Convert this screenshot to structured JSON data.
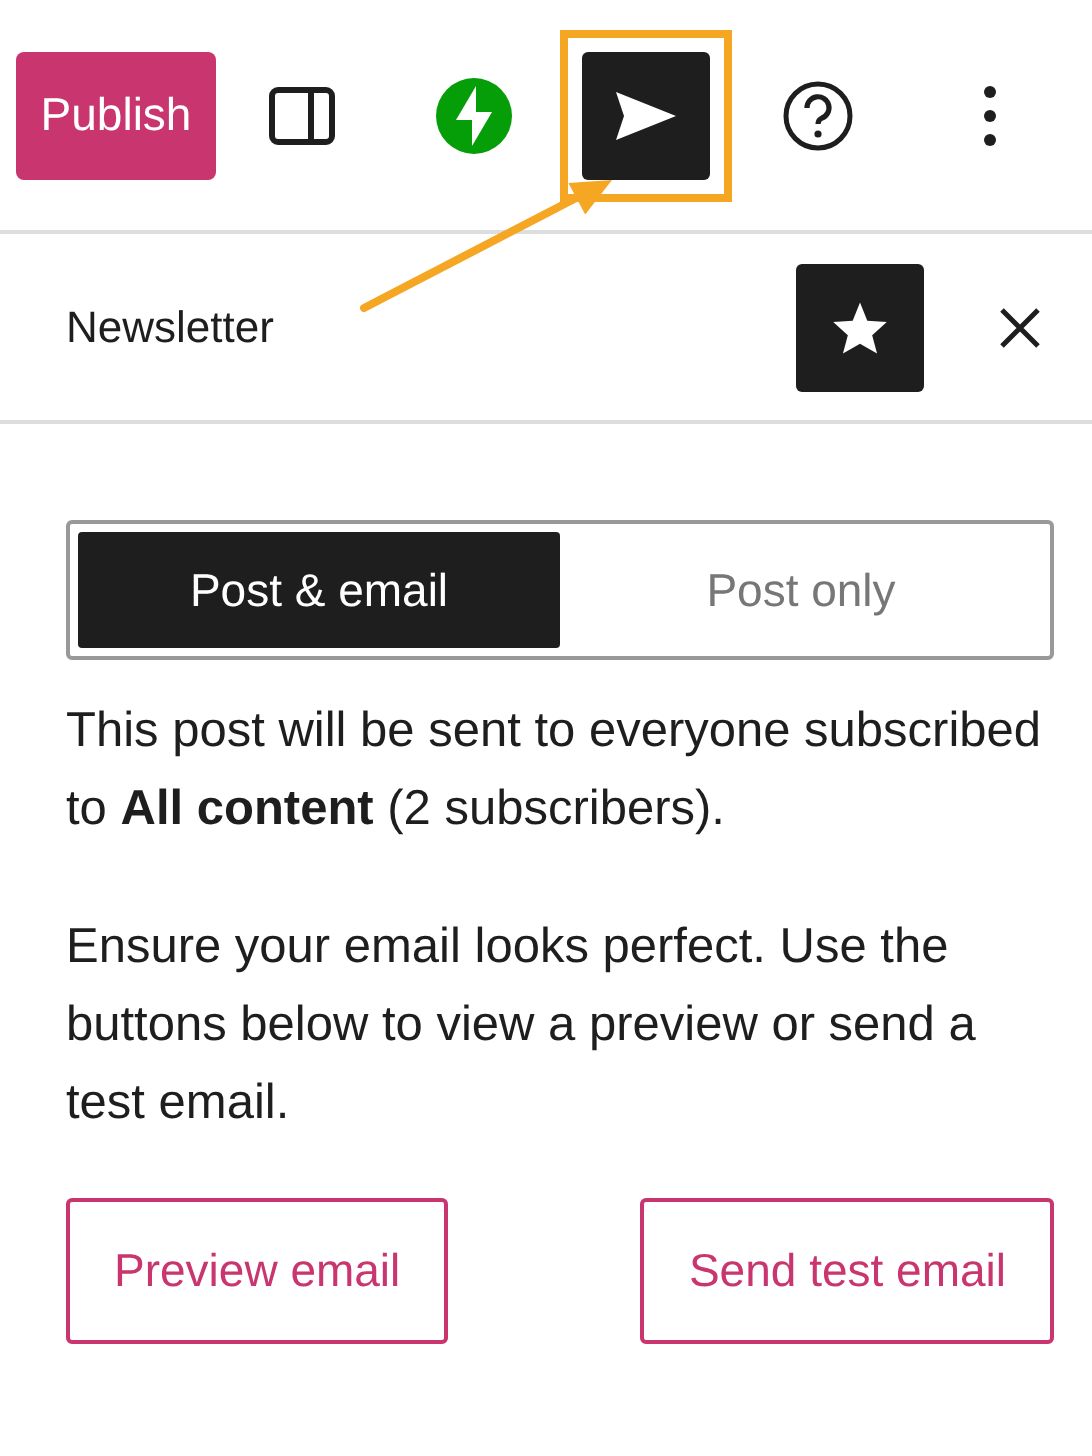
{
  "toolbar": {
    "publish_button": "Publish",
    "items": [
      {
        "kind": "sidebar",
        "pressed": false,
        "highlighted": false
      },
      {
        "kind": "jetpack",
        "pressed": false,
        "highlighted": false
      },
      {
        "kind": "send",
        "pressed": true,
        "highlighted": true
      },
      {
        "kind": "help",
        "pressed": false,
        "highlighted": false
      },
      {
        "kind": "more",
        "pressed": false,
        "highlighted": false
      }
    ]
  },
  "panel": {
    "title": "Newsletter",
    "starred": true,
    "toggle": [
      {
        "label": "Post & email",
        "selected": true
      },
      {
        "label": "Post only",
        "selected": false
      }
    ],
    "paragraphs": [
      "This post will be sent to everyone subscribed to **All content** (2 subscribers).",
      "Ensure your email looks perfect. Use the buttons below to view a preview or send a test email."
    ],
    "buttons": [
      "Preview email",
      "Send test email"
    ]
  }
}
